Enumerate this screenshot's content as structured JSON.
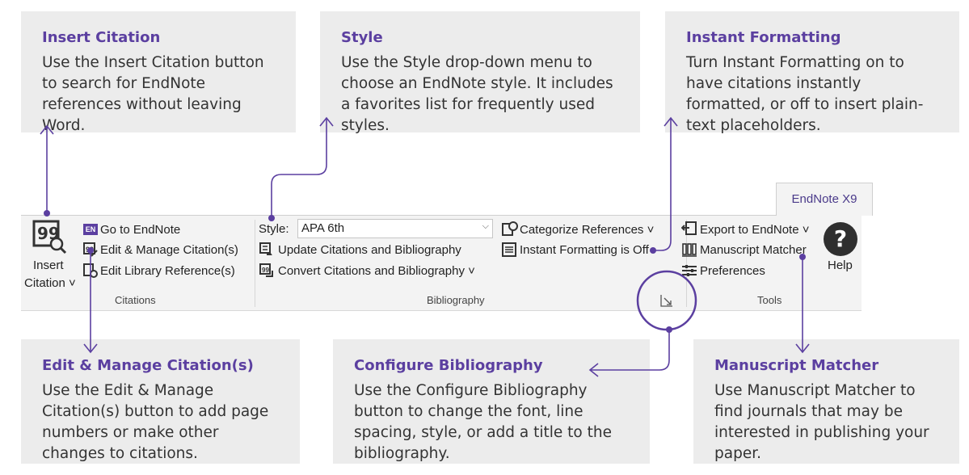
{
  "callouts": {
    "insert_citation": {
      "title": "Insert Citation",
      "body": "Use the Insert Citation button to search for EndNote references without leaving Word."
    },
    "style": {
      "title": "Style",
      "body": "Use the Style drop-down menu to choose an EndNote style. It includes a favorites list for frequently used styles."
    },
    "instant_formatting": {
      "title": "Instant Formatting",
      "body": "Turn Instant Formatting on to have citations instantly formatted, or off to insert plain-text placeholders."
    },
    "edit_manage": {
      "title": "Edit & Manage Citation(s)",
      "body": "Use the Edit & Manage Citation(s) button to add page numbers or make other changes to citations."
    },
    "configure_bibliography": {
      "title": "Configure Bibliography",
      "body": "Use the Configure Bibliography button to change the font, line spacing, style, or add a title to the bibliography."
    },
    "manuscript_matcher": {
      "title": "Manuscript Matcher",
      "body": "Use Manuscript Matcher to find journals that may be interested in publishing your paper."
    }
  },
  "ribbon": {
    "tab_label": "EndNote X9",
    "citations": {
      "insert_line1": "Insert",
      "insert_line2": "Citation ˅",
      "go_to_endnote": "Go to EndNote",
      "edit_manage": "Edit & Manage Citation(s)",
      "edit_library": "Edit Library Reference(s)",
      "group_label": "Citations"
    },
    "bibliography": {
      "style_label": "Style:",
      "style_value": "APA 6th",
      "update": "Update Citations and Bibliography",
      "convert": "Convert Citations and Bibliography ˅",
      "categorize": "Categorize References ˅",
      "instant_formatting": "Instant Formatting is Off",
      "group_label": "Bibliography"
    },
    "tools": {
      "export": "Export to EndNote ˅",
      "manuscript_matcher": "Manuscript Matcher",
      "preferences": "Preferences",
      "help": "Help",
      "group_label": "Tools"
    }
  },
  "colors": {
    "accent": "#5b3fa0",
    "callout_bg": "#ececec",
    "ribbon_bg": "#f3f3f3"
  },
  "icons": {
    "insert": "insert-citation-icon",
    "help": "help-icon",
    "launcher": "dialog-launcher-icon"
  }
}
